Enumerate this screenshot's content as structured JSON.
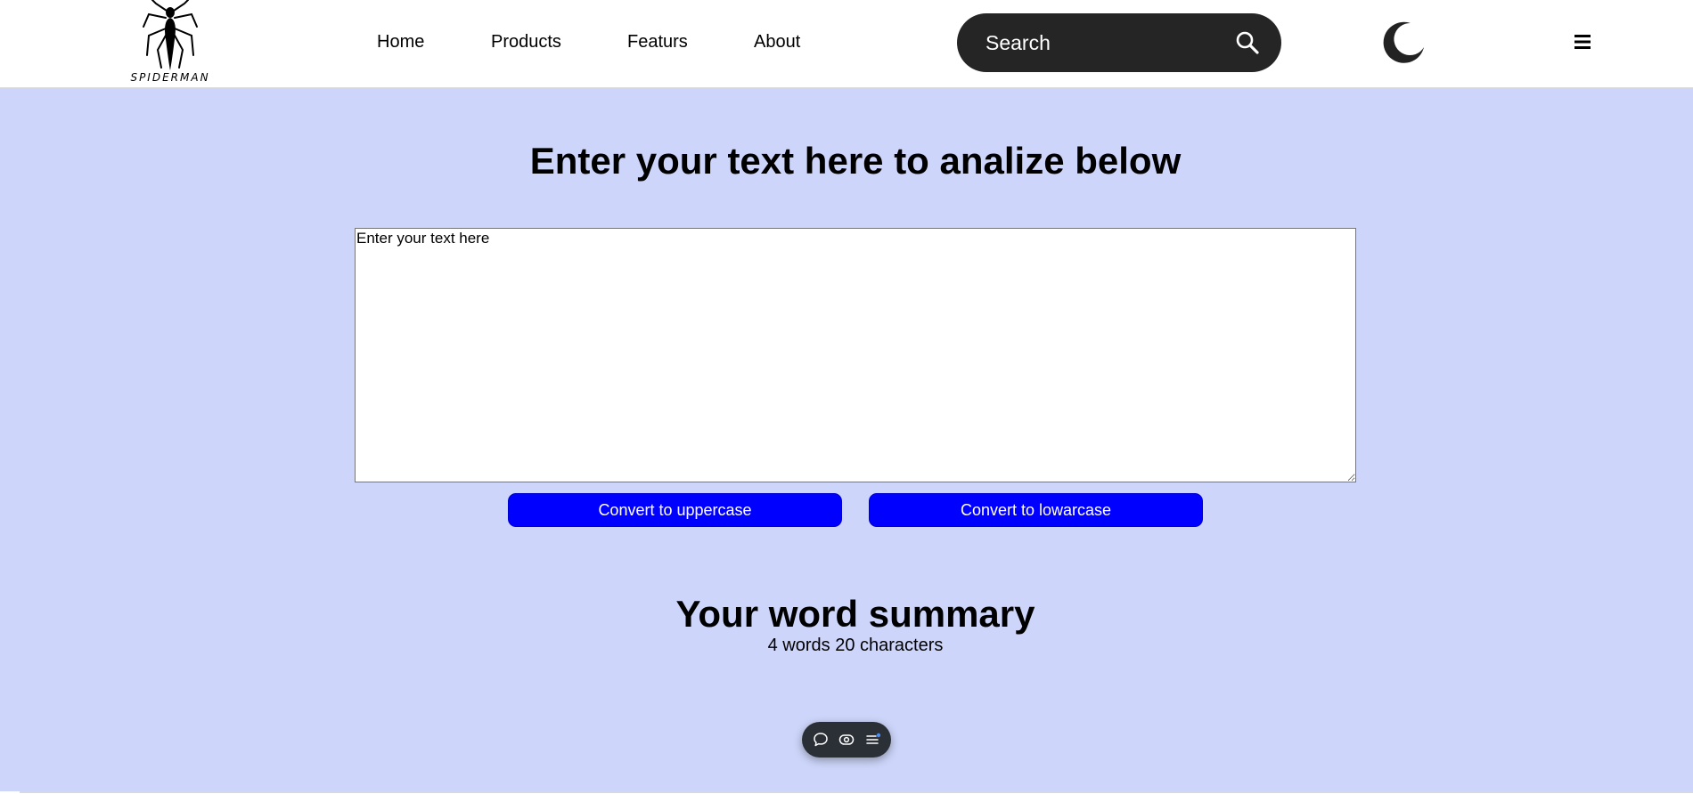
{
  "logo": {
    "text": "SPIDERMAN",
    "icon": "spider-icon"
  },
  "nav": {
    "items": [
      {
        "label": "Home"
      },
      {
        "label": "Products"
      },
      {
        "label": "Featurs"
      },
      {
        "label": "About"
      }
    ]
  },
  "search": {
    "placeholder": "Search",
    "icon": "search-icon"
  },
  "theme_toggle": {
    "icon": "moon-icon"
  },
  "menu": {
    "icon": "hamburger-menu-icon"
  },
  "main": {
    "title": "Enter your text here to analize below",
    "textarea_placeholder": "Enter your text here",
    "buttons": {
      "uppercase": "Convert to uppercase",
      "lowercase": "Convert to lowarcase"
    },
    "summary_title": "Your word summary",
    "summary_text": "4 words 20 characters"
  },
  "toolbar": {
    "icons": [
      "chat-bubble-icon",
      "eye-toggle-icon",
      "list-menu-icon"
    ]
  },
  "colors": {
    "page_background": "#cdd6fa",
    "button": "#0000ff",
    "search_box": "#252525",
    "toolbar": "#2b2f36"
  }
}
